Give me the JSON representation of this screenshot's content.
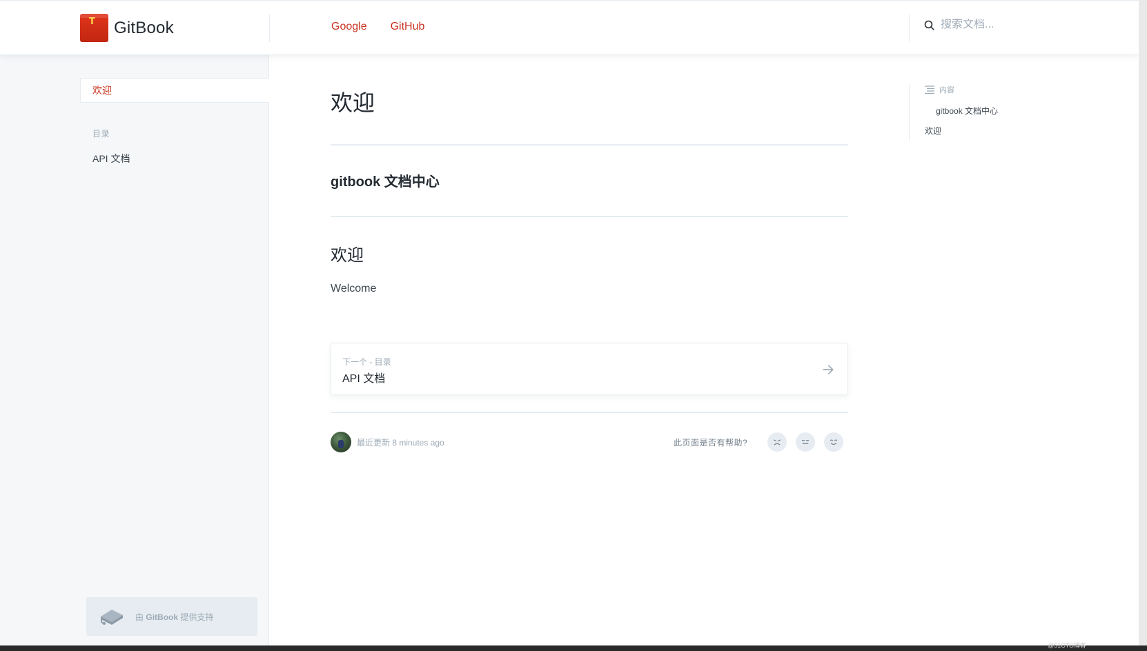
{
  "header": {
    "logo_text": "GitBook",
    "logo_glyph": "T",
    "links": [
      "Google",
      "GitHub"
    ],
    "search_placeholder": "搜索文档..."
  },
  "sidebar": {
    "active_item": "欢迎",
    "section_title": "目录",
    "items": [
      "API 文档"
    ],
    "powered_by": {
      "prefix": "由",
      "brand": "GitBook",
      "suffix": "提供支持"
    }
  },
  "main": {
    "title": "欢迎",
    "subtitle": "gitbook 文档中心",
    "heading": "欢迎",
    "paragraph": "Welcome",
    "next": {
      "hint": "下一个 - 目录",
      "title": "API 文档"
    },
    "footer": {
      "updated": "最近更新 8 minutes ago",
      "helpful_question": "此页面是否有帮助?"
    }
  },
  "toc": {
    "heading": "内容",
    "items": [
      "gitbook 文档中心",
      "欢迎"
    ]
  },
  "watermark": "@51CTO博客",
  "colors": {
    "accent": "#c9321f",
    "sidebar_bg": "#f5f7f9",
    "border": "#e6ecf1",
    "muted_text": "#9daab6"
  }
}
